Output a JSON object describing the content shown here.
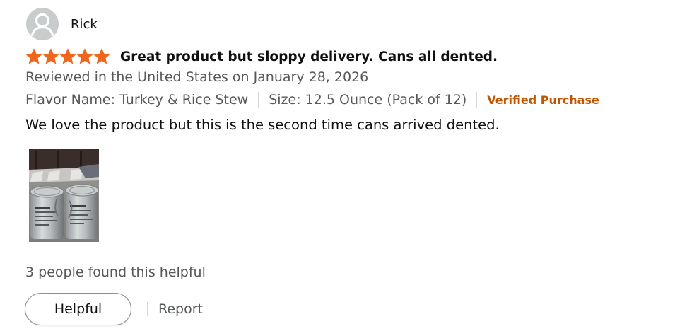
{
  "reviewer": {
    "name": "Rick",
    "avatar_icon": "default-user-avatar-icon"
  },
  "rating": {
    "stars": 5,
    "max_stars": 5,
    "star_color": "#f1651d",
    "star_icon": "star-icon"
  },
  "review": {
    "title": "Great product but sloppy delivery. Cans all dented.",
    "date_line": "Reviewed in the United States on January 28, 2026",
    "flavor": "Flavor Name: Turkey & Rice Stew",
    "size": "Size: 12.5 Ounce (Pack of 12)",
    "verified_label": "Verified Purchase",
    "verified_color": "#c45500",
    "body": "We love the product but this is the second time cans arrived dented."
  },
  "image": {
    "subject": "two-dented-cans-photo"
  },
  "feedback": {
    "helpful_count_text": "3 people found this helpful",
    "helpful_button_label": "Helpful",
    "report_label": "Report"
  }
}
